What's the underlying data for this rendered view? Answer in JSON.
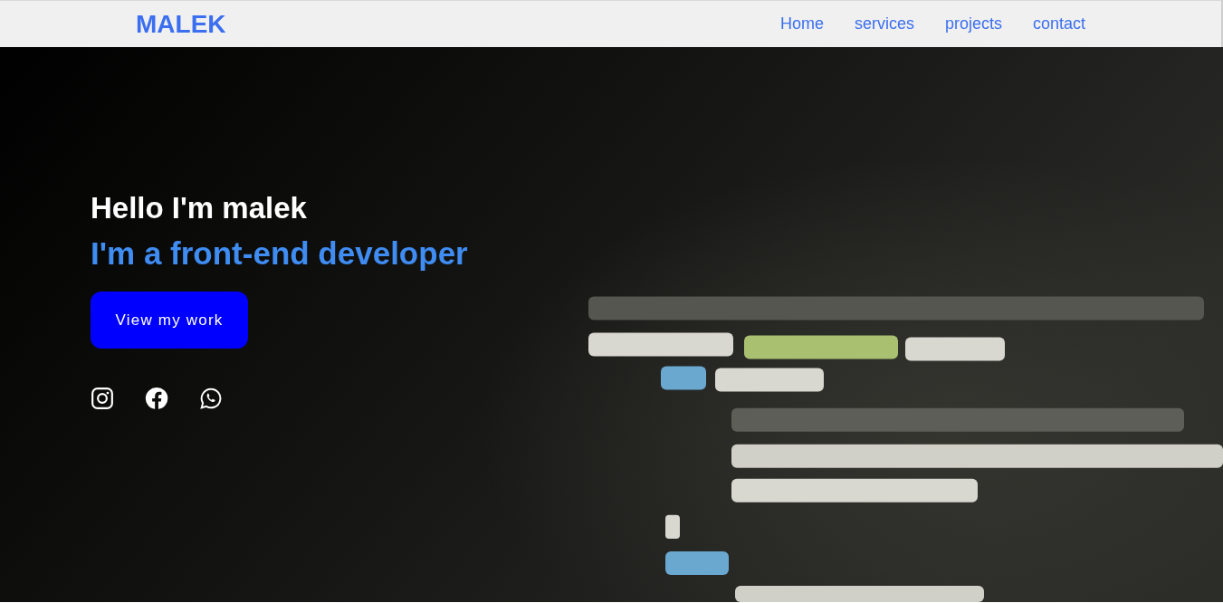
{
  "header": {
    "logo": "MALEK",
    "nav": [
      {
        "label": "Home"
      },
      {
        "label": "services"
      },
      {
        "label": "projects"
      },
      {
        "label": "contact"
      }
    ]
  },
  "hero": {
    "kind": "picture",
    "greeting": "Hello I'm malek",
    "role": "I'm a front-end developer",
    "button": "View my work",
    "social": [
      {
        "kind": "instagram"
      },
      {
        "kind": "facebook"
      },
      {
        "kind": "whatsapp"
      }
    ]
  }
}
